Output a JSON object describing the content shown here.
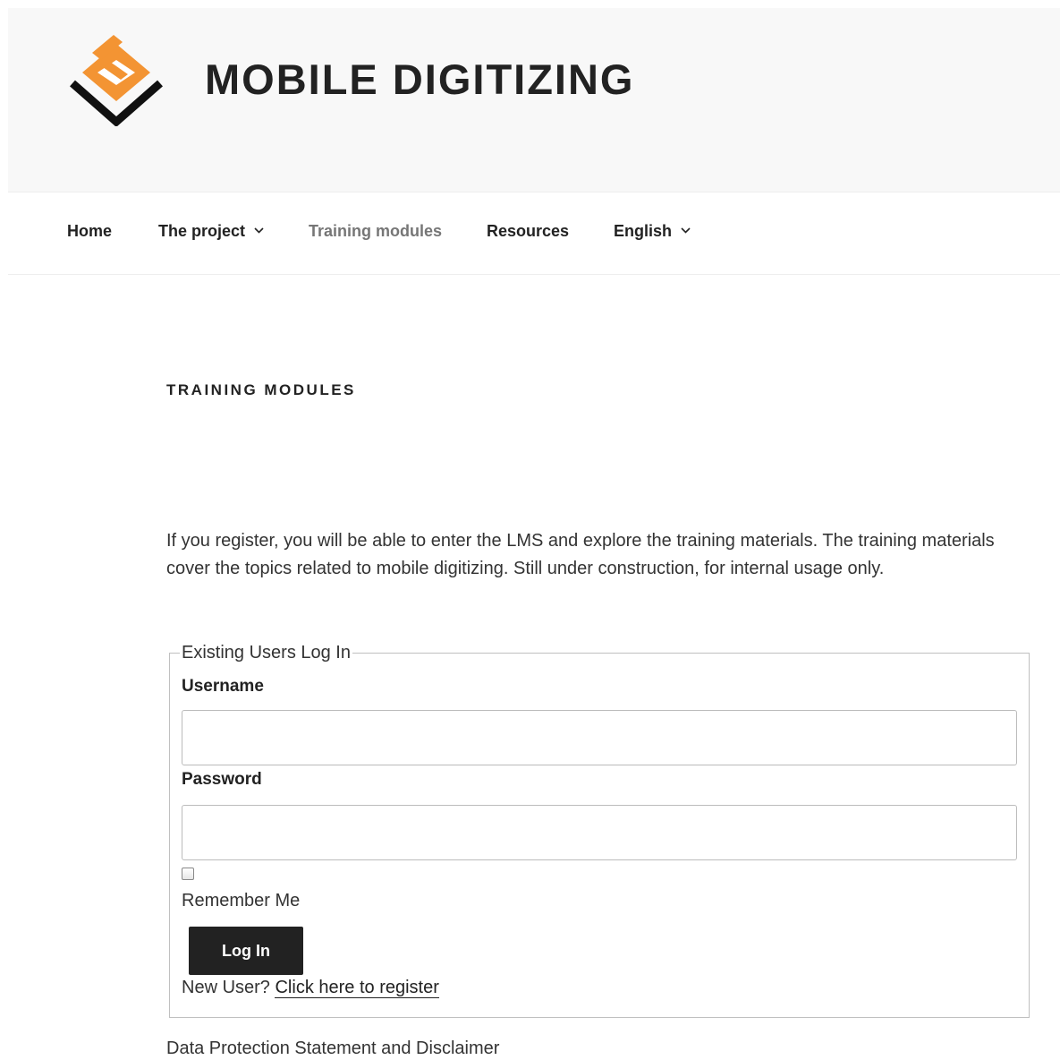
{
  "header": {
    "site_title": "MOBILE DIGITIZING",
    "logo_icon": "md-diamond-logo-icon",
    "logo_colors": {
      "orange": "#f39433",
      "dark": "#111111"
    }
  },
  "nav": {
    "items": [
      {
        "label": "Home",
        "has_dropdown": false,
        "current": false
      },
      {
        "label": "The project",
        "has_dropdown": true,
        "current": false
      },
      {
        "label": "Training modules",
        "has_dropdown": false,
        "current": true
      },
      {
        "label": "Resources",
        "has_dropdown": false,
        "current": false
      },
      {
        "label": "English",
        "has_dropdown": true,
        "current": false
      }
    ]
  },
  "main": {
    "page_title": "TRAINING MODULES",
    "intro": "If you register, you will be able to enter the LMS and explore the training materials. The training materials cover the topics related to mobile digitizing. Still under construction, for internal usage only."
  },
  "login_form": {
    "legend": "Existing Users Log In",
    "username_label": "Username",
    "username_value": "",
    "password_label": "Password",
    "password_value": "",
    "remember_checked": false,
    "remember_label": "Remember Me",
    "submit_label": "Log In",
    "new_user_text": "New User?",
    "register_link": "Click here to register"
  },
  "footer": {
    "link": "Data Protection Statement and Disclaimer"
  },
  "colors": {
    "header_bg": "#f8f8f8",
    "text": "#222222",
    "nav_current": "#767676",
    "button_bg": "#222222"
  }
}
